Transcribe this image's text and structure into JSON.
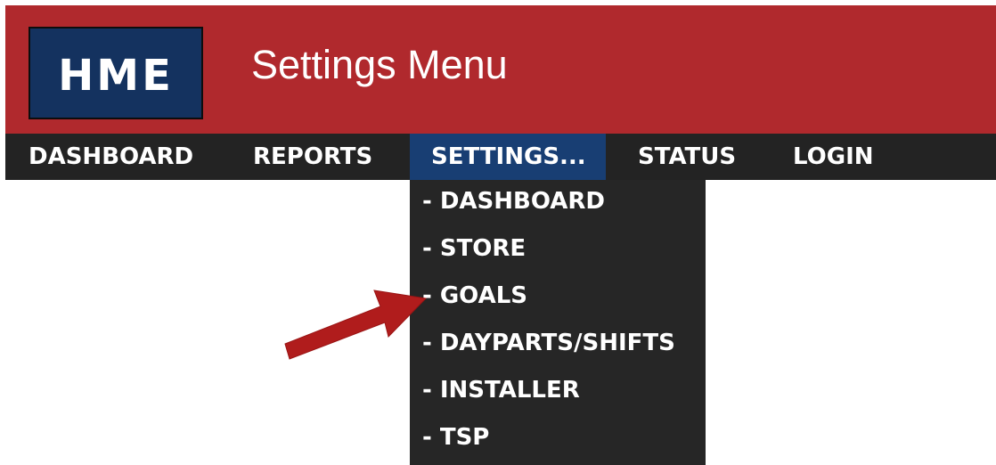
{
  "header": {
    "logo_text": "HME",
    "title": "Settings Menu"
  },
  "nav": {
    "items": [
      {
        "label": "DASHBOARD"
      },
      {
        "label": "REPORTS"
      },
      {
        "label": "SETTINGS..."
      },
      {
        "label": "STATUS"
      },
      {
        "label": "LOGIN"
      }
    ],
    "active": "SETTINGS..."
  },
  "dropdown": {
    "items": [
      {
        "label": "- DASHBOARD"
      },
      {
        "label": "- STORE"
      },
      {
        "label": "- GOALS"
      },
      {
        "label": "- DAYPARTS/SHIFTS"
      },
      {
        "label": "- INSTALLER"
      },
      {
        "label": "- TSP"
      }
    ],
    "highlighted": "- GOALS"
  },
  "colors": {
    "header_red": "#b0292d",
    "logo_navy": "#14325f",
    "nav_dark": "#232323",
    "active_blue": "#183e73",
    "annotation_arrow": "#b01c1c"
  },
  "icons": {
    "submenu": "chevron-right-icon",
    "annotation": "red-arrow-icon"
  }
}
